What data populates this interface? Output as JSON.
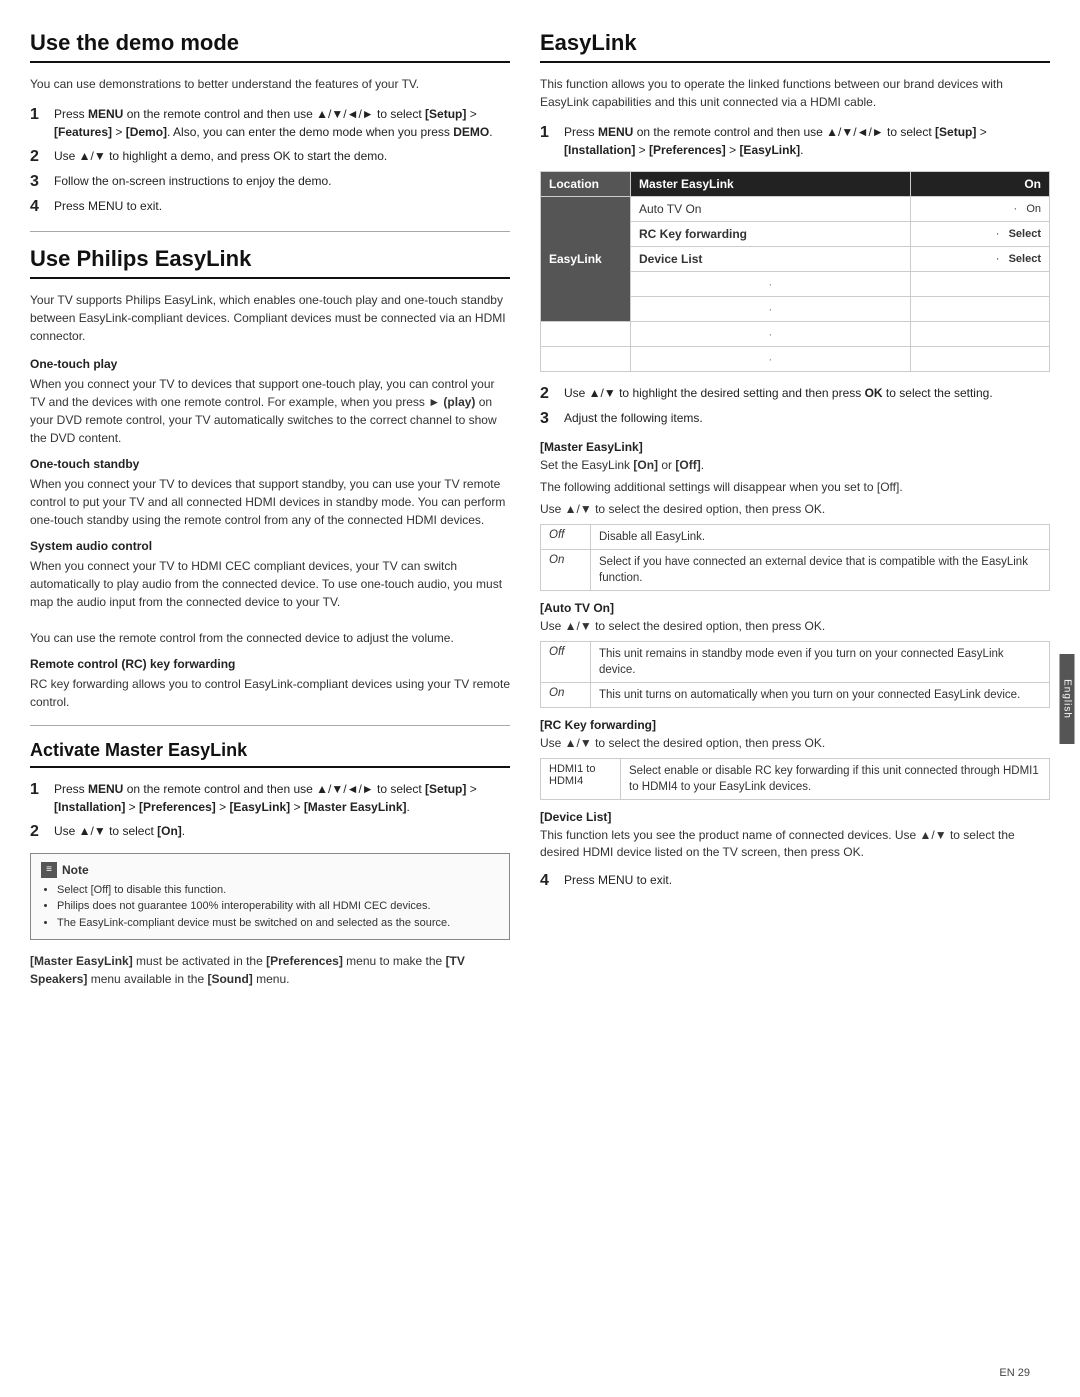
{
  "left": {
    "demo_section": {
      "title": "Use the demo mode",
      "desc": "You can use demonstrations to better understand the features of your TV.",
      "steps": [
        {
          "num": "1",
          "text": "Press MENU on the remote control and then use ▲/▼/◄/► to select [Setup] > [Features] > [Demo]. Also, you can enter the demo mode when you press DEMO."
        },
        {
          "num": "2",
          "text": "Use ▲/▼ to highlight a demo, and press OK to start the demo."
        },
        {
          "num": "3",
          "text": "Follow the on-screen instructions to enjoy the demo."
        },
        {
          "num": "4",
          "text": "Press MENU to exit."
        }
      ]
    },
    "philips_section": {
      "title": "Use Philips EasyLink",
      "desc": "Your TV supports Philips EasyLink, which enables one-touch play and one-touch standby between EasyLink-compliant devices. Compliant devices must be connected via an HDMI connector.",
      "subsections": [
        {
          "title": "One-touch play",
          "body": "When you connect your TV to devices that support one-touch play, you can control your TV and the devices with one remote control. For example, when you press ► (play) on your DVD remote control, your TV automatically switches to the correct channel to show the DVD content."
        },
        {
          "title": "One-touch standby",
          "body": "When you connect your TV to devices that support standby, you can use your TV remote control to put your TV and all connected HDMI devices in standby mode. You can perform one-touch standby using the remote control from any of the connected HDMI devices."
        },
        {
          "title": "System audio control",
          "body": "When you connect your TV to HDMI CEC compliant devices, your TV can switch automatically to play audio from the connected device. To use one-touch audio, you must map the audio input from the connected device to your TV.\n\nYou can use the remote control from the connected device to adjust the volume."
        },
        {
          "title": "Remote control (RC) key forwarding",
          "body": "RC key forwarding allows you to control EasyLink-compliant devices using your TV remote control."
        }
      ]
    },
    "activate_section": {
      "title": "Activate Master EasyLink",
      "steps": [
        {
          "num": "1",
          "text": "Press MENU on the remote control and then use ▲/▼/◄/► to select [Setup] > [Installation] > [Preferences] > [EasyLink] > [Master EasyLink]."
        },
        {
          "num": "2",
          "text": "Use ▲/▼ to select [On]."
        }
      ],
      "note": {
        "title": "Note",
        "items": [
          "Select [Off] to disable this function.",
          "Philips does not guarantee 100% interoperability with all HDMI CEC devices.",
          "The EasyLink-compliant device must be switched on and selected as the source."
        ]
      },
      "bracket_note": "[Master EasyLink] must be activated in the [Preferences] menu to make the [TV Speakers] menu available in the [Sound] menu."
    }
  },
  "right": {
    "easylink_section": {
      "title": "EasyLink",
      "desc": "This function allows you to operate the linked functions between our brand devices with EasyLink capabilities and this unit connected via a HDMI cable.",
      "step1": "Press MENU on the remote control and then use ▲/▼/◄/► to select [Setup] > [Installation] > [Preferences] > [EasyLink].",
      "table": {
        "headers": [
          "Location",
          "Master EasyLink",
          "On"
        ],
        "row_easylink": "EasyLink",
        "rows": [
          {
            "label": "Auto TV On",
            "dot": "·",
            "action": "On"
          },
          {
            "label": "RC Key forwarding",
            "dot": "·",
            "action": "Select"
          },
          {
            "label": "Device List",
            "dot": "·",
            "action": "Select"
          },
          {
            "label": "",
            "dot": "·",
            "action": ""
          },
          {
            "label": "",
            "dot": "·",
            "action": ""
          },
          {
            "label": "",
            "dot": "·",
            "action": ""
          },
          {
            "label": "",
            "dot": "·",
            "action": ""
          }
        ]
      },
      "step2": "Use ▲/▼ to highlight the desired setting and then press OK to select the setting.",
      "step3": "Adjust the following items.",
      "master_label": "[Master EasyLink]",
      "master_desc": "Set the EasyLink [On] or [Off].",
      "master_desc2": "The following additional settings will disappear when you set to [Off].",
      "use_note": "Use ▲/▼ to select the desired option, then press OK.",
      "master_options": [
        {
          "label": "Off",
          "desc": "Disable all EasyLink."
        },
        {
          "label": "On",
          "desc": "Select if you have connected an external device that is compatible with the EasyLink function."
        }
      ],
      "autotv_label": "[Auto TV On]",
      "autotv_use_note": "Use ▲/▼ to select the desired option, then press OK.",
      "autotv_options": [
        {
          "label": "Off",
          "desc": "This unit remains in standby mode even if you turn on your connected EasyLink device."
        },
        {
          "label": "On",
          "desc": "This unit turns on automatically when you turn on your connected EasyLink device."
        }
      ],
      "rc_label": "[RC Key forwarding]",
      "rc_use_note": "Use ▲/▼ to select the desired option, then press OK.",
      "rc_options_label": "HDMI1 to HDMI4",
      "rc_options_desc": "Select enable or disable RC key forwarding if this unit connected through HDMI1 to HDMI4 to your EasyLink devices.",
      "device_label": "[Device List]",
      "device_desc": "This function lets you see the product name of connected devices. Use ▲/▼ to select the desired HDMI device listed on the TV screen, then press OK.",
      "step4": "Press MENU to exit."
    }
  },
  "footer": {
    "text": "EN   29"
  },
  "side_tab": {
    "label": "English"
  }
}
